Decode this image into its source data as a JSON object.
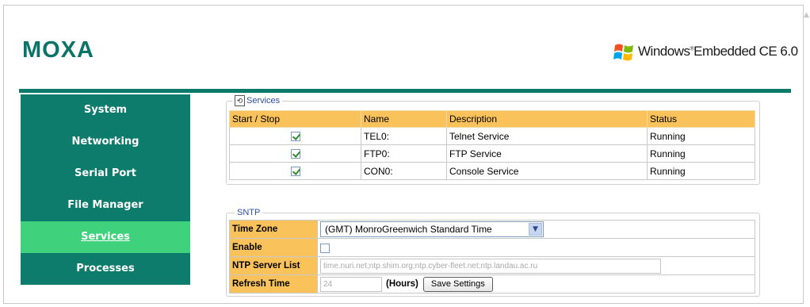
{
  "header": {
    "brand": "MOXA",
    "os_brand": "Windows",
    "os_brand_tm": "®",
    "os_product": "Embedded CE 6.0"
  },
  "sidebar": {
    "items": [
      {
        "label": "System",
        "active": false
      },
      {
        "label": "Networking",
        "active": false
      },
      {
        "label": "Serial Port",
        "active": false
      },
      {
        "label": "File Manager",
        "active": false
      },
      {
        "label": "Services",
        "active": true
      },
      {
        "label": "Processes",
        "active": false
      }
    ]
  },
  "services": {
    "legend": "Services",
    "columns": [
      "Start / Stop",
      "Name",
      "Description",
      "Status"
    ],
    "rows": [
      {
        "checked": true,
        "name": "TEL0:",
        "description": "Telnet Service",
        "status": "Running"
      },
      {
        "checked": true,
        "name": "FTP0:",
        "description": "FTP Service",
        "status": "Running"
      },
      {
        "checked": true,
        "name": "CON0:",
        "description": "Console Service",
        "status": "Running"
      }
    ]
  },
  "sntp": {
    "legend": "SNTP",
    "time_zone_label": "Time Zone",
    "time_zone_value": "(GMT) MonroGreenwich Standard Time",
    "enable_label": "Enable",
    "enable_checked": false,
    "ntp_label": "NTP Server List",
    "ntp_value": "time.nuri.net;ntp.shim.org;ntp.cyber-fleet.net;ntp.landau.ac.ru",
    "refresh_label": "Refresh Time",
    "refresh_value": "24",
    "hours_label": "(Hours)",
    "save_label": "Save Settings"
  },
  "colors": {
    "brand_teal": "#0a7466",
    "nav_bg": "#0e7c6c",
    "nav_active": "#3fd17c",
    "header_orange": "#f9c25a"
  }
}
